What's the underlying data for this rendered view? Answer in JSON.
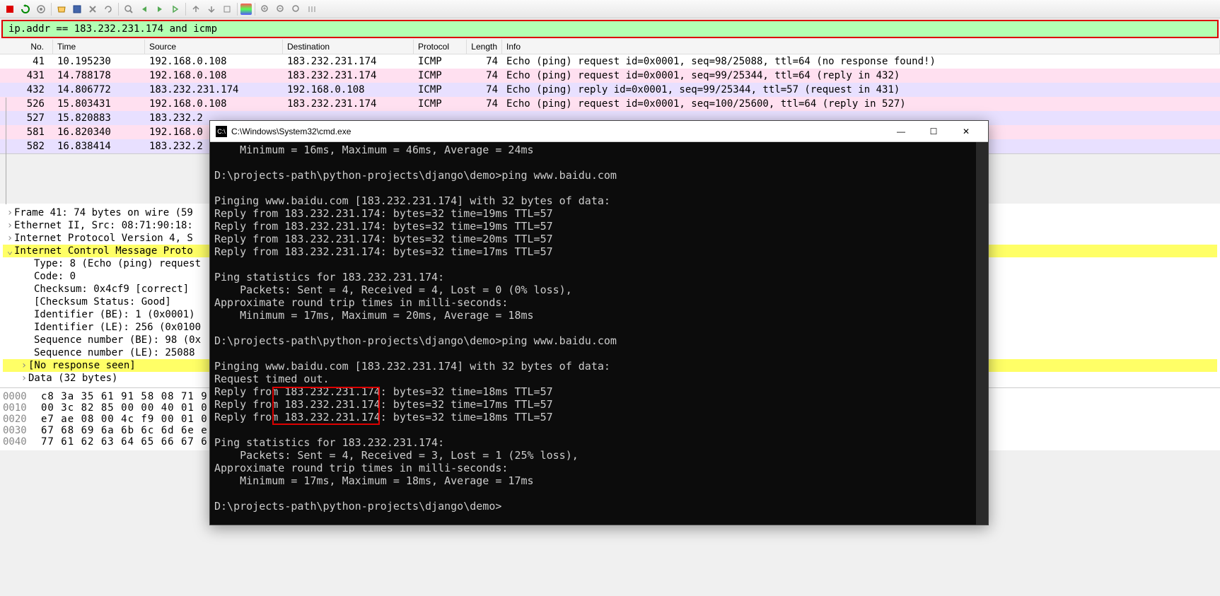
{
  "filter": {
    "expression": "ip.addr ==  183.232.231.174 and icmp"
  },
  "table": {
    "headers": [
      "No.",
      "Time",
      "Source",
      "Destination",
      "Protocol",
      "Length",
      "Info"
    ],
    "rows": [
      {
        "no": "41",
        "time": "10.195230",
        "src": "192.168.0.108",
        "dst": "183.232.231.174",
        "proto": "ICMP",
        "len": "74",
        "info": "Echo (ping) request  id=0x0001, seq=98/25088, ttl=64 (no response found!)",
        "cls": ""
      },
      {
        "no": "431",
        "time": "14.788178",
        "src": "192.168.0.108",
        "dst": "183.232.231.174",
        "proto": "ICMP",
        "len": "74",
        "info": "Echo (ping) request  id=0x0001, seq=99/25344, ttl=64 (reply in 432)",
        "cls": "pink"
      },
      {
        "no": "432",
        "time": "14.806772",
        "src": "183.232.231.174",
        "dst": "192.168.0.108",
        "proto": "ICMP",
        "len": "74",
        "info": "Echo (ping) reply    id=0x0001, seq=99/25344, ttl=57 (request in 431)",
        "cls": "purple"
      },
      {
        "no": "526",
        "time": "15.803431",
        "src": "192.168.0.108",
        "dst": "183.232.231.174",
        "proto": "ICMP",
        "len": "74",
        "info": "Echo (ping) request  id=0x0001, seq=100/25600, ttl=64 (reply in 527)",
        "cls": "pink"
      },
      {
        "no": "527",
        "time": "15.820883",
        "src": "183.232.2",
        "dst": "",
        "proto": "",
        "len": "",
        "info": "",
        "cls": "purple"
      },
      {
        "no": "581",
        "time": "16.820340",
        "src": "192.168.0",
        "dst": "",
        "proto": "",
        "len": "",
        "info": "",
        "cls": "pink"
      },
      {
        "no": "582",
        "time": "16.838414",
        "src": "183.232.2",
        "dst": "",
        "proto": "",
        "len": "",
        "info": "",
        "cls": "purple"
      }
    ]
  },
  "detail": {
    "frame": "Frame 41: 74 bytes on wire (59",
    "eth": "Ethernet II, Src: 08:71:90:18:",
    "ip": "Internet Protocol Version 4, S",
    "icmp": "Internet Control Message Proto",
    "type": "Type: 8 (Echo (ping) request",
    "code": "Code: 0",
    "checksum": "Checksum: 0x4cf9 [correct]",
    "ckstatus": "[Checksum Status: Good]",
    "id_be": "Identifier (BE): 1 (0x0001)",
    "id_le": "Identifier (LE): 256 (0x0100",
    "seq_be": "Sequence number (BE): 98 (0x",
    "seq_le": "Sequence number (LE): 25088",
    "noresp": "[No response seen]",
    "data": "Data (32 bytes)"
  },
  "hex": {
    "rows": [
      {
        "off": "0000",
        "b": "c8 3a 35 61 91 58 08 71  9"
      },
      {
        "off": "0010",
        "b": "00 3c 82 85 00 00 40 01  0"
      },
      {
        "off": "0020",
        "b": "e7 ae 08 00 4c f9 00 01  0"
      },
      {
        "off": "0030",
        "b": "67 68 69 6a 6b 6c 6d 6e  e"
      },
      {
        "off": "0040",
        "b": "77 61 62 63 64 65 66 67  6"
      }
    ]
  },
  "cmd": {
    "title": "C:\\Windows\\System32\\cmd.exe",
    "lines": [
      "    Minimum = 16ms, Maximum = 46ms, Average = 24ms",
      "",
      "D:\\projects-path\\python-projects\\django\\demo>ping www.baidu.com",
      "",
      "Pinging www.baidu.com [183.232.231.174] with 32 bytes of data:",
      "Reply from 183.232.231.174: bytes=32 time=19ms TTL=57",
      "Reply from 183.232.231.174: bytes=32 time=19ms TTL=57",
      "Reply from 183.232.231.174: bytes=32 time=20ms TTL=57",
      "Reply from 183.232.231.174: bytes=32 time=17ms TTL=57",
      "",
      "Ping statistics for 183.232.231.174:",
      "    Packets: Sent = 4, Received = 4, Lost = 0 (0% loss),",
      "Approximate round trip times in milli-seconds:",
      "    Minimum = 17ms, Maximum = 20ms, Average = 18ms",
      "",
      "D:\\projects-path\\python-projects\\django\\demo>ping www.baidu.com",
      "",
      "Pinging www.baidu.com [183.232.231.174] with 32 bytes of data:",
      "Request timed out.",
      "Reply from 183.232.231.174: bytes=32 time=18ms TTL=57",
      "Reply from 183.232.231.174: bytes=32 time=17ms TTL=57",
      "Reply from 183.232.231.174: bytes=32 time=18ms TTL=57",
      "",
      "Ping statistics for 183.232.231.174:",
      "    Packets: Sent = 4, Received = 3, Lost = 1 (25% loss),",
      "Approximate round trip times in milli-seconds:",
      "    Minimum = 17ms, Maximum = 18ms, Average = 17ms",
      "",
      "D:\\projects-path\\python-projects\\django\\demo>"
    ]
  }
}
